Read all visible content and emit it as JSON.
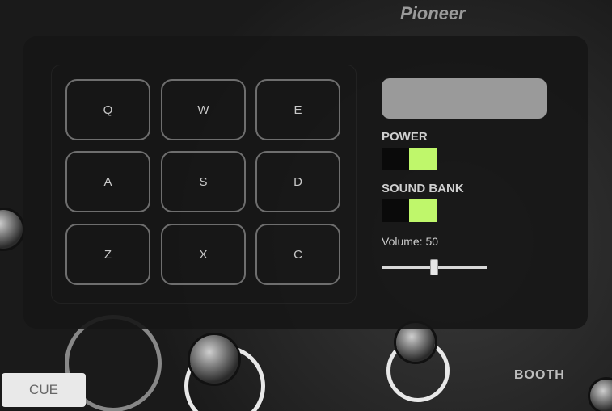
{
  "pads": [
    {
      "key": "Q"
    },
    {
      "key": "W"
    },
    {
      "key": "E"
    },
    {
      "key": "A"
    },
    {
      "key": "S"
    },
    {
      "key": "D"
    },
    {
      "key": "Z"
    },
    {
      "key": "X"
    },
    {
      "key": "C"
    }
  ],
  "controls": {
    "display_text": "",
    "power_label": "POWER",
    "power_on": true,
    "bank_label": "SOUND BANK",
    "bank_on": true,
    "toggle_color": "#bff76b",
    "volume_label": "Volume: 50",
    "volume_value": 50,
    "volume_max": 100
  },
  "backdrop": {
    "cue_label": "CUE",
    "booth_label": "BOOTH",
    "brand_label": "Pioneer"
  }
}
